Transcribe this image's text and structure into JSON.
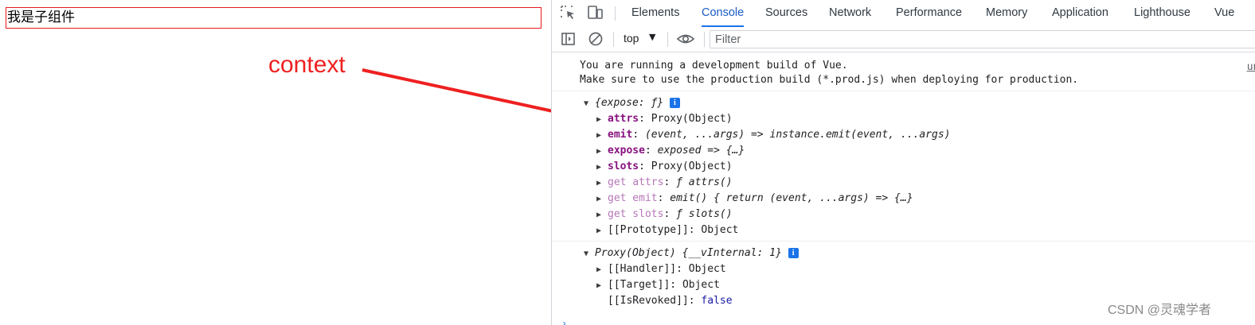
{
  "page": {
    "child_text": "我是子组件",
    "annotation_label": "context",
    "annotation_color": "#ef2020"
  },
  "devtools": {
    "tabs": [
      {
        "label": "Elements",
        "active": false
      },
      {
        "label": "Console",
        "active": true
      },
      {
        "label": "Sources",
        "active": false
      },
      {
        "label": "Network",
        "active": false
      },
      {
        "label": "Performance",
        "active": false
      },
      {
        "label": "Memory",
        "active": false
      },
      {
        "label": "Application",
        "active": false
      },
      {
        "label": "Lighthouse",
        "active": false
      },
      {
        "label": "Vue",
        "active": false
      }
    ],
    "toolbar": {
      "context": "top",
      "filter_placeholder": "Filter"
    },
    "icons": [
      "inspect-element-icon",
      "device-toolbar-icon",
      "sidebar-toggle-icon",
      "clear-console-icon",
      "dropdown-arrow-icon",
      "live-expression-eye-icon",
      "info-icon"
    ],
    "accent": "#1a73e8"
  },
  "console": {
    "messages": [
      "You are running a development build of Vue.",
      "Make sure to use the production build (*.prod.js) when deploying for production."
    ],
    "source_link": "unpk",
    "object1": {
      "summary": "{expose: ƒ}",
      "props": [
        {
          "name": "attrs",
          "value": "Proxy(Object)"
        },
        {
          "name": "emit",
          "value": "(event, ...args) => instance.emit(event, ...args)"
        },
        {
          "name": "expose",
          "value": "exposed => {…}"
        },
        {
          "name": "slots",
          "value": "Proxy(Object)"
        }
      ],
      "getters": [
        {
          "name": "get attrs",
          "value": "ƒ attrs()"
        },
        {
          "name": "get emit",
          "value": "emit() { return (event, ...args) => {…}"
        },
        {
          "name": "get slots",
          "value": "ƒ slots()"
        }
      ],
      "prototype": "[[Prototype]]",
      "prototype_value": "Object"
    },
    "object2": {
      "summary": "Proxy(Object) {__vInternal: 1}",
      "handler": "[[Handler]]",
      "handler_value": "Object",
      "target": "[[Target]]",
      "target_value": "Object",
      "revoked": "[[IsRevoked]]",
      "revoked_value": "false"
    }
  },
  "watermark": "CSDN @灵魂学者"
}
